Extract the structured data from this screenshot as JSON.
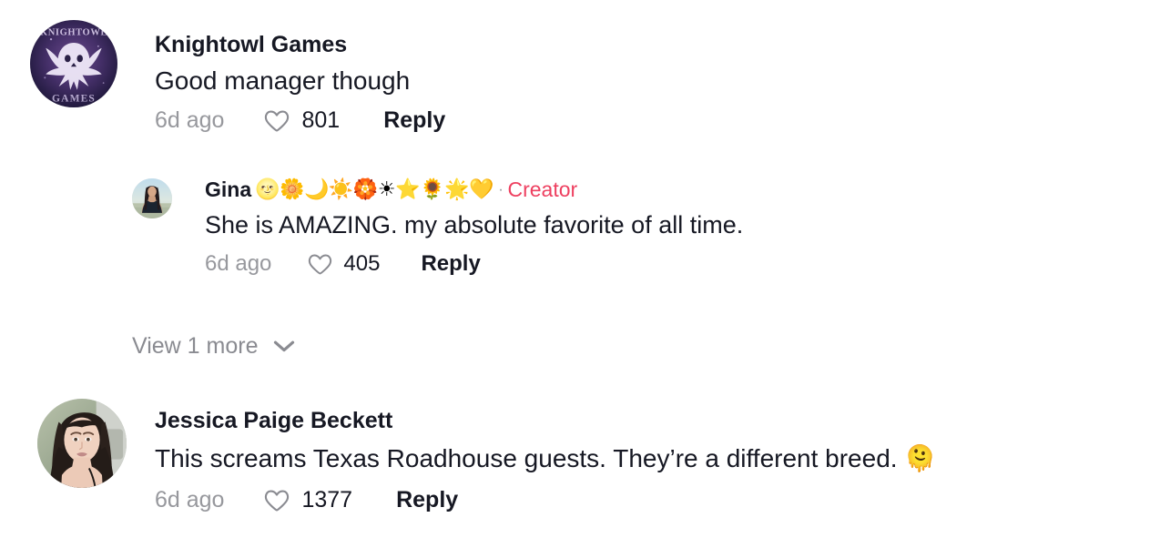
{
  "colors": {
    "text_primary": "#161823",
    "text_muted": "#97989d",
    "creator_accent": "#ee4060",
    "background": "#ffffff",
    "heart_stroke": "#8a8b91"
  },
  "comments": [
    {
      "username": "Knightowl Games",
      "name_emoji": "",
      "badge": "",
      "text": "Good manager though",
      "text_emoji": "",
      "timestamp": "6d ago",
      "like_count": "801",
      "reply_label": "Reply",
      "avatar_name": "knightowl-games-avatar",
      "heart_icon": "heart-outline-icon"
    },
    {
      "username": "Gina",
      "name_emoji": "🌝🌼🌙☀️🏵️☀⭐🌻🌟💛",
      "separator": "·",
      "badge": "Creator",
      "text": "She is AMAZING. my absolute favorite of all time.",
      "text_emoji": "",
      "timestamp": "6d ago",
      "like_count": "405",
      "reply_label": "Reply",
      "avatar_name": "gina-avatar",
      "heart_icon": "heart-outline-icon"
    },
    {
      "username": "Jessica Paige Beckett",
      "name_emoji": "",
      "badge": "",
      "text": "This screams Texas Roadhouse guests. They’re a different breed. ",
      "text_emoji": "🫠",
      "timestamp": "6d ago",
      "like_count": "1377",
      "reply_label": "Reply",
      "avatar_name": "jessica-paige-beckett-avatar",
      "heart_icon": "heart-outline-icon"
    }
  ],
  "view_more": {
    "label": "View 1 more",
    "chevron_icon": "chevron-down-icon"
  }
}
